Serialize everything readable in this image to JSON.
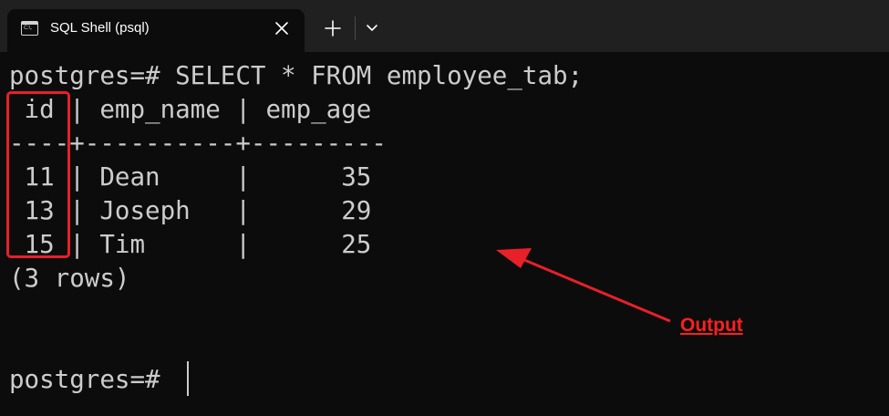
{
  "window": {
    "tab_title": "SQL Shell (psql)",
    "tab_icon": "console-window-icon",
    "tab_icon_text": "C:\\."
  },
  "toolbar": {
    "close_icon": "close-icon",
    "new_tab_icon": "plus-icon",
    "dropdown_icon": "chevron-down-icon"
  },
  "terminal": {
    "lines": [
      "postgres=# SELECT * FROM employee_tab;",
      " id | emp_name | emp_age",
      "----+----------+---------",
      " 11 | Dean     |      35",
      " 13 | Joseph   |      29",
      " 15 | Tim      |      25",
      "(3 rows)",
      "",
      "",
      "postgres=# "
    ]
  },
  "annotation": {
    "label": "Output",
    "color": "#ff1f1f"
  },
  "colors": {
    "terminal_bg": "#0c0c0c",
    "tabbar_bg": "#202020",
    "text": "#cccccc",
    "accent_red": "#e8202a"
  }
}
